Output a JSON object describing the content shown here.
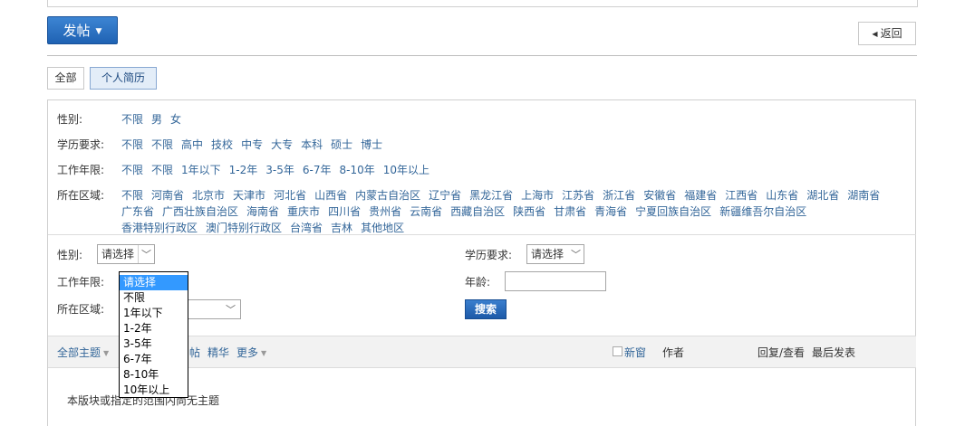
{
  "header": {
    "post_button": "发帖",
    "back_button": "返回"
  },
  "tabs": [
    {
      "label": "全部"
    },
    {
      "label": "个人简历"
    }
  ],
  "filters": {
    "gender": {
      "label": "性别:",
      "options": [
        "不限",
        "男",
        "女"
      ]
    },
    "education": {
      "label": "学历要求:",
      "options": [
        "不限",
        "不限",
        "高中",
        "技校",
        "中专",
        "大专",
        "本科",
        "硕士",
        "博士"
      ]
    },
    "experience": {
      "label": "工作年限:",
      "options": [
        "不限",
        "不限",
        "1年以下",
        "1-2年",
        "3-5年",
        "6-7年",
        "8-10年",
        "10年以上"
      ]
    },
    "region": {
      "label": "所在区域:",
      "options": [
        "不限",
        "河南省",
        "北京市",
        "天津市",
        "河北省",
        "山西省",
        "内蒙古自治区",
        "辽宁省",
        "黑龙江省",
        "上海市",
        "江苏省",
        "浙江省",
        "安徽省",
        "福建省",
        "江西省",
        "山东省",
        "湖北省",
        "湖南省",
        "广东省",
        "广西壮族自治区",
        "海南省",
        "重庆市",
        "四川省",
        "贵州省",
        "云南省",
        "西藏自治区",
        "陕西省",
        "甘肃省",
        "青海省",
        "宁夏回族自治区",
        "新疆维吾尔自治区",
        "香港特别行政区",
        "澳门特别行政区",
        "台湾省",
        "吉林",
        "其他地区"
      ]
    }
  },
  "search_form": {
    "gender_label": "性别:",
    "gender_value": "请选择",
    "education_label": "学历要求:",
    "education_value": "请选择",
    "experience_label": "工作年限:",
    "age_label": "年龄:",
    "age_value": "",
    "region_label": "所在区域:",
    "search_button": "搜索"
  },
  "dropdown": {
    "options": [
      "请选择",
      "不限",
      "1年以下",
      "1-2年",
      "3-5年",
      "6-7年",
      "8-10年",
      "10年以上"
    ],
    "highlighted": "请选择"
  },
  "toolbar": {
    "all_topics": "全部主题",
    "partial_text": "帖",
    "digest": "精华",
    "more": "更多",
    "new_window": "新窗",
    "author": "作者",
    "reply_view": "回复/查看",
    "last_post": "最后发表"
  },
  "empty_message": "本版块或指定的范围内尚无主题",
  "colors": {
    "primary_button": "#2a6fc2",
    "link": "#336699",
    "dropdown_highlight": "#3399ff"
  },
  "icons": {
    "post_caret": "caret-down-icon",
    "back": "triangle-left-icon",
    "select": "chevron-down-icon"
  }
}
